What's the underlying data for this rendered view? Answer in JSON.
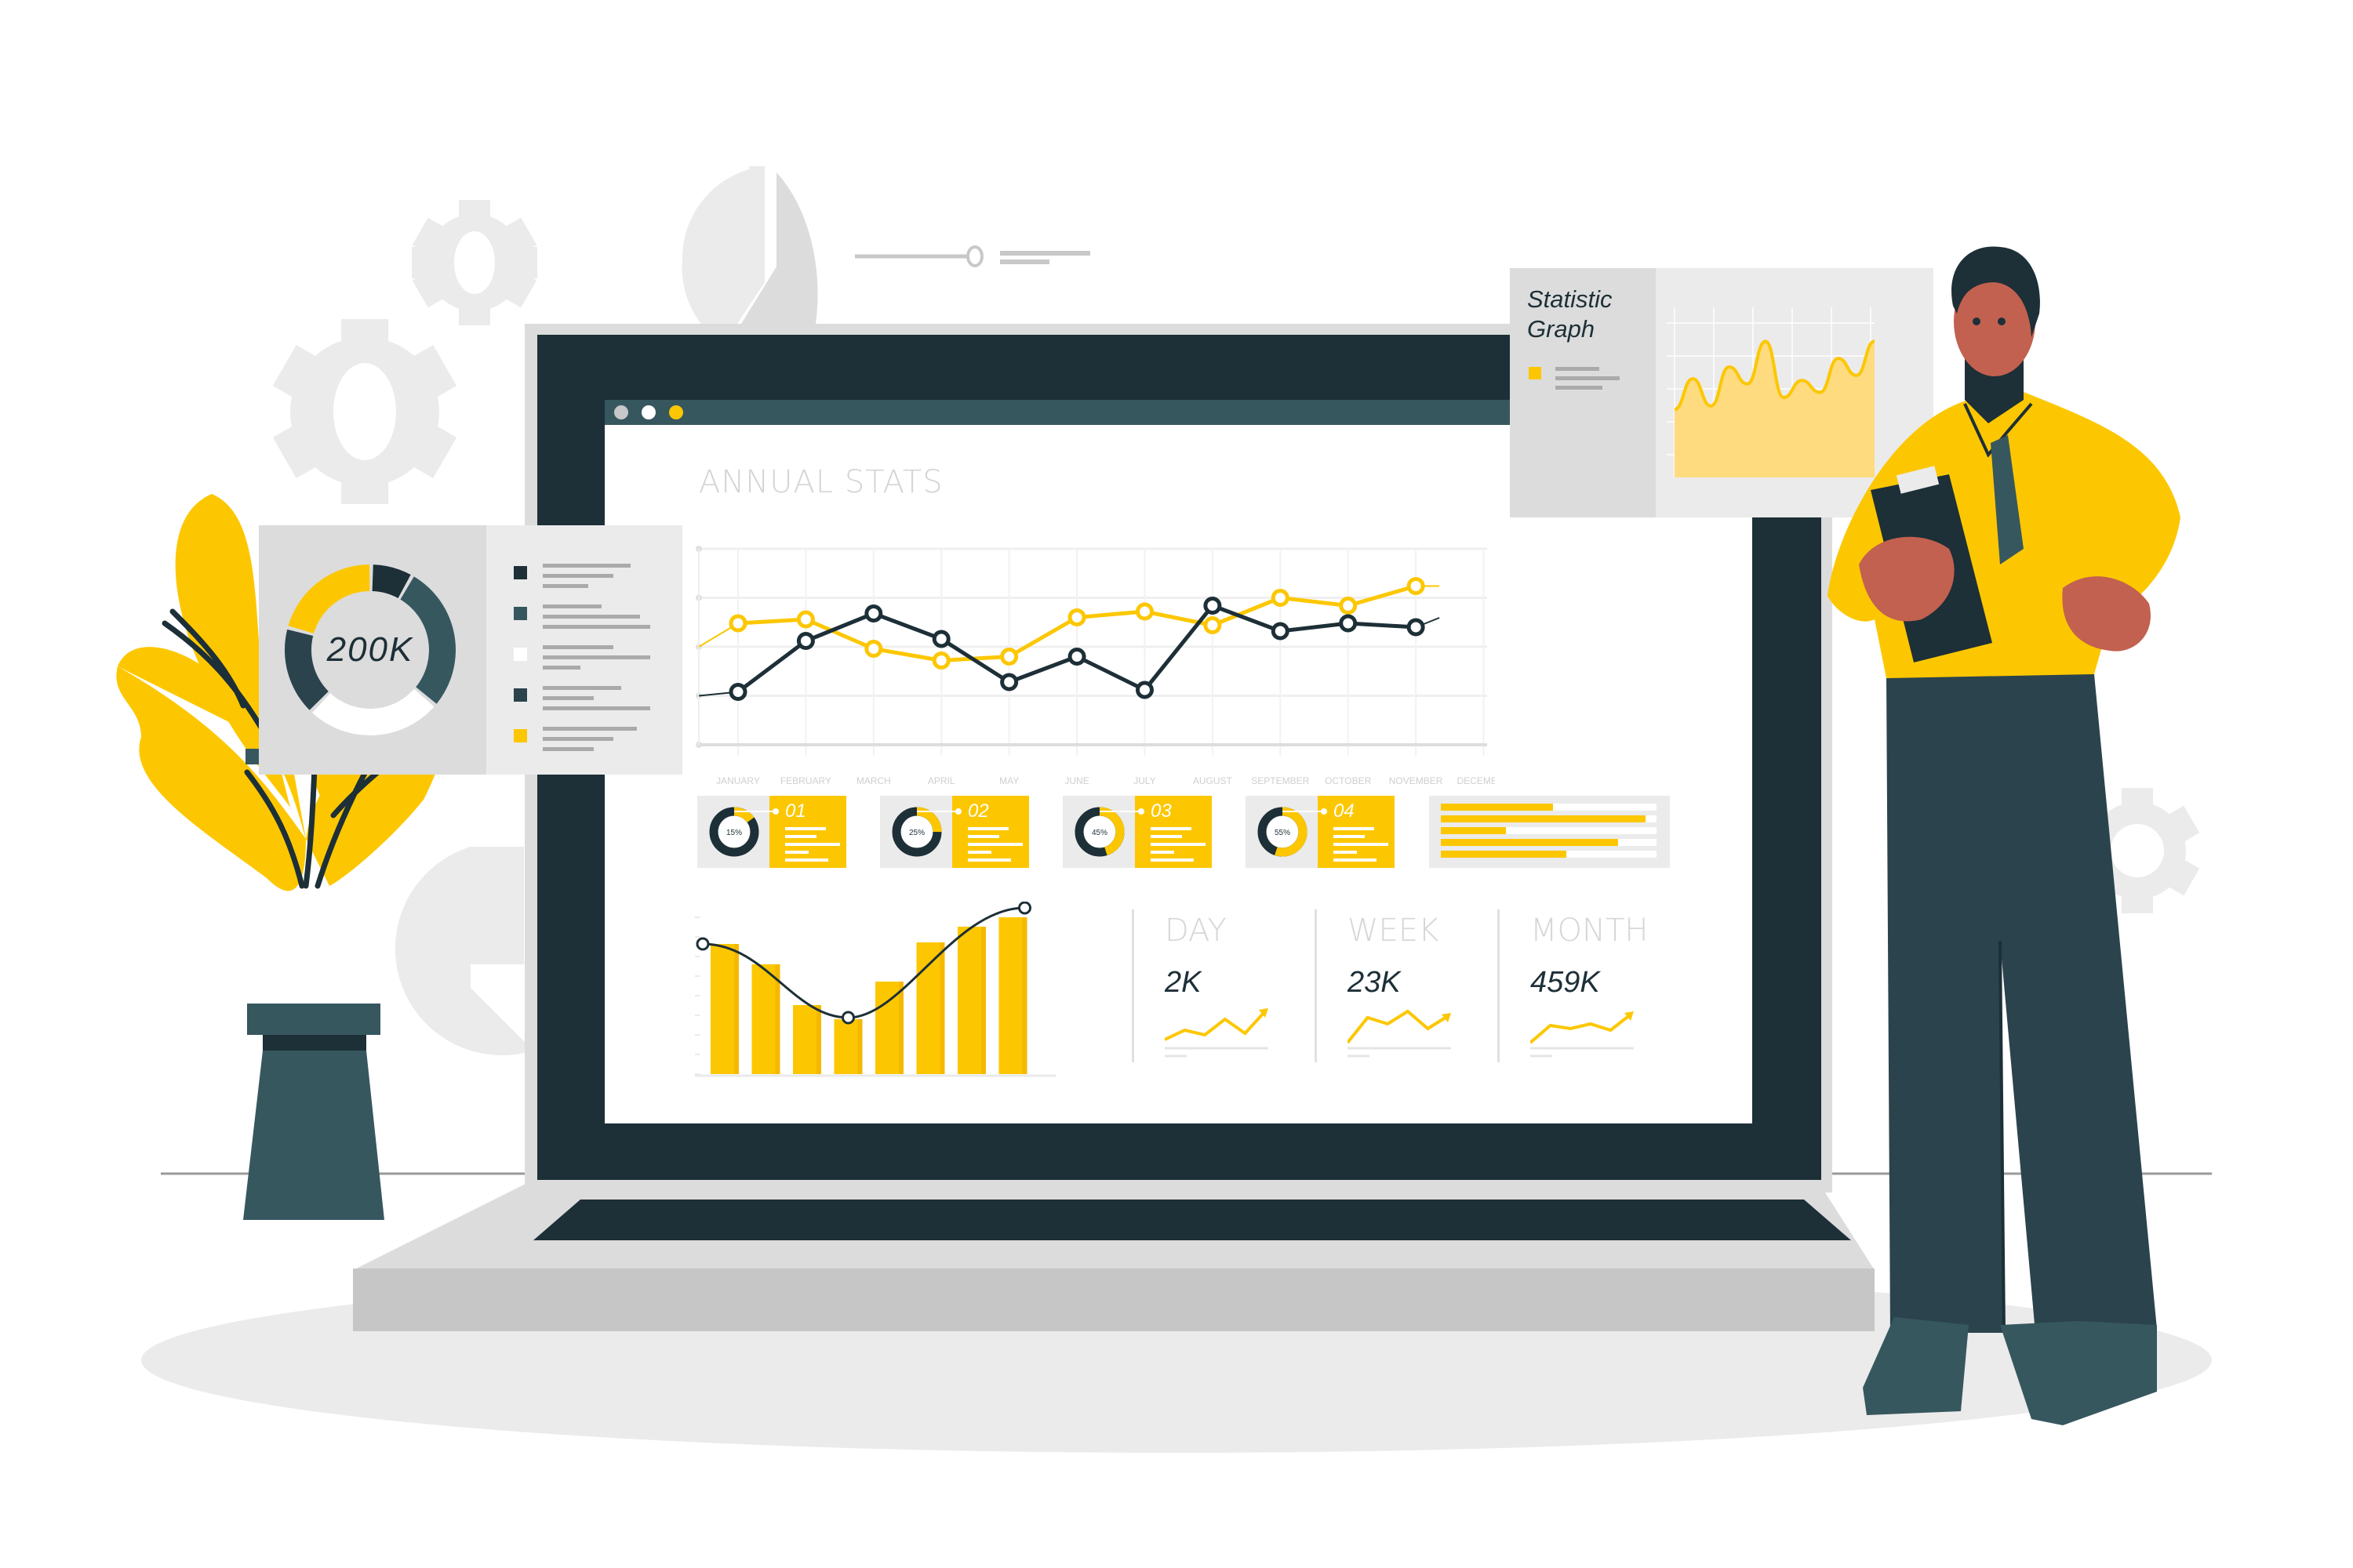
{
  "colors": {
    "yellow": "#FCC700",
    "yellow_light": "#FDDB7E",
    "dark": "#1D2F37",
    "teal": "#37575F",
    "slate": "#2B434C",
    "grey_light": "#EBEBEB",
    "grey_mid": "#DCDCDC",
    "grey_text": "#C8C8C8",
    "skin": "#C2614F"
  },
  "browser": {
    "dots": [
      "grey",
      "white",
      "yellow"
    ]
  },
  "dashboard": {
    "title": "ANNUAL STATS",
    "kpi_cards": [
      {
        "percent_label": "15%",
        "percent": 15,
        "number": "01"
      },
      {
        "percent_label": "25%",
        "percent": 25,
        "number": "02"
      },
      {
        "percent_label": "45%",
        "percent": 45,
        "number": "03"
      },
      {
        "percent_label": "55%",
        "percent": 55,
        "number": "04"
      }
    ],
    "progress_bars": [
      0.52,
      0.95,
      0.3,
      0.82,
      0.58
    ],
    "stats": [
      {
        "label": "DAY",
        "value": "2K",
        "trend": [
          10,
          40,
          25,
          75,
          30,
          100
        ]
      },
      {
        "label": "WEEK",
        "value": "23K",
        "trend": [
          0,
          80,
          60,
          100,
          45,
          85
        ]
      },
      {
        "label": "MONTH",
        "value": "459K",
        "trend": [
          0,
          55,
          45,
          60,
          40,
          90
        ]
      }
    ]
  },
  "donut_panel": {
    "center_label": "200K",
    "segments": [
      {
        "name": "dark",
        "share": 0.08
      },
      {
        "name": "teal",
        "share": 0.28
      },
      {
        "name": "white",
        "share": 0.26
      },
      {
        "name": "slate",
        "share": 0.17
      },
      {
        "name": "yellow",
        "share": 0.21
      }
    ],
    "legend": [
      "dark",
      "teal",
      "white",
      "slate",
      "yellow"
    ]
  },
  "statistic_panel": {
    "title_line1": "Statistic",
    "title_line2": "Graph",
    "area_values": [
      40,
      58,
      42,
      65,
      55,
      80,
      47,
      57,
      50,
      70,
      60,
      80
    ]
  },
  "chart_data": [
    {
      "type": "line",
      "title": "ANNUAL STATS",
      "categories": [
        "JANUARY",
        "FEBRUARY",
        "MARCH",
        "APRIL",
        "MAY",
        "JUNE",
        "JULY",
        "AUGUST",
        "SEPTEMBER",
        "OCTOBER",
        "NOVEMBER",
        "DECEMBER"
      ],
      "series": [
        {
          "name": "yellow",
          "color": "#FCC700",
          "values": [
            62,
            64,
            49,
            43,
            45,
            65,
            68,
            61,
            75,
            71,
            81,
            null
          ]
        },
        {
          "name": "dark",
          "color": "#1D2F37",
          "values": [
            27,
            53,
            67,
            54,
            32,
            45,
            28,
            71,
            58,
            62,
            60,
            null
          ]
        }
      ],
      "ylim": [
        0,
        100
      ],
      "grid": true,
      "legend": "none"
    },
    {
      "type": "bar",
      "title": "",
      "categories": [
        "1",
        "2",
        "3",
        "4",
        "5",
        "6",
        "7",
        "8"
      ],
      "values": [
        83,
        70,
        44,
        35,
        59,
        84,
        94,
        100
      ],
      "overlay_curve_points": [
        83,
        35,
        100
      ],
      "ylim": [
        0,
        100
      ],
      "grid": false
    }
  ]
}
